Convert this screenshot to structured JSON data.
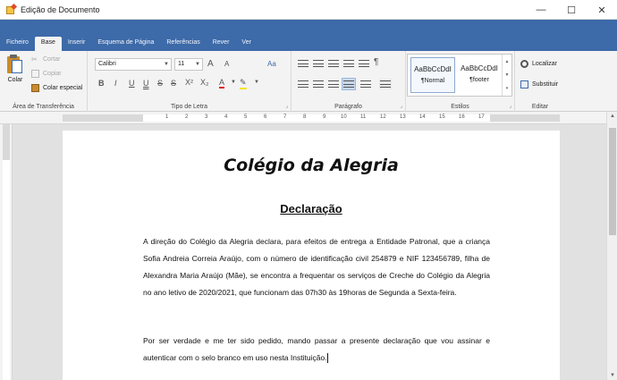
{
  "window": {
    "title": "Edição de Documento",
    "controls": [
      "—",
      "☐",
      "✕"
    ]
  },
  "tabs": [
    "Ficheiro",
    "Base",
    "Inserir",
    "Esquema de Página",
    "Referências",
    "Rever",
    "Ver"
  ],
  "active_tab": "Base",
  "ribbon": {
    "clipboard": {
      "paste": "Colar",
      "cut": "Cortar",
      "copy": "Copiar",
      "paste_special": "Colar especial",
      "label": "Área de Transferência"
    },
    "font": {
      "family": "Calibri",
      "size": "11",
      "grow": "A",
      "shrink": "A",
      "case": "Aa",
      "bold": "B",
      "italic": "I",
      "underline": "U",
      "double_underline": "U",
      "strike": "S",
      "double_strike": "S",
      "superscript": "X²",
      "subscript": "X₂",
      "font_color": "A",
      "highlight": "✎",
      "label": "Tipo de Letra"
    },
    "paragraph": {
      "show_marks": "¶",
      "label": "Parágrafo"
    },
    "styles": {
      "items": [
        {
          "sample": "AaBbCcDdI",
          "name": "¶Normal"
        },
        {
          "sample": "AaBbCcDdI",
          "name": "¶footer"
        }
      ],
      "label": "Estilos"
    },
    "editing": {
      "find": "Localizar",
      "replace": "Substituir",
      "label": "Editar"
    }
  },
  "ruler": {
    "numbers": [
      "1",
      "2",
      "3",
      "4",
      "5",
      "6",
      "7",
      "8",
      "9",
      "10",
      "11",
      "12",
      "13",
      "14",
      "15",
      "16",
      "17"
    ]
  },
  "document": {
    "title": "Colégio da Alegria",
    "heading": "Declaração",
    "paragraphs": [
      "A direção do Colégio da Alegria declara, para efeitos de entrega a Entidade Patronal, que a criança Sofia Andreia Correia Araújo, com o número de identificação civil 254879 e NIF 123456789, filha de Alexandra Maria Araújo (Mãe), se encontra a frequentar os serviços de Creche do Colégio da Alegria no ano letivo de 2020/2021, que funcionam das 07h30 às 19horas de Segunda a Sexta-feira.",
      "Por ser verdade e me ter sido pedido, mando passar a presente declaração que vou assinar e autenticar com o selo branco em uso nesta Instituição."
    ]
  }
}
